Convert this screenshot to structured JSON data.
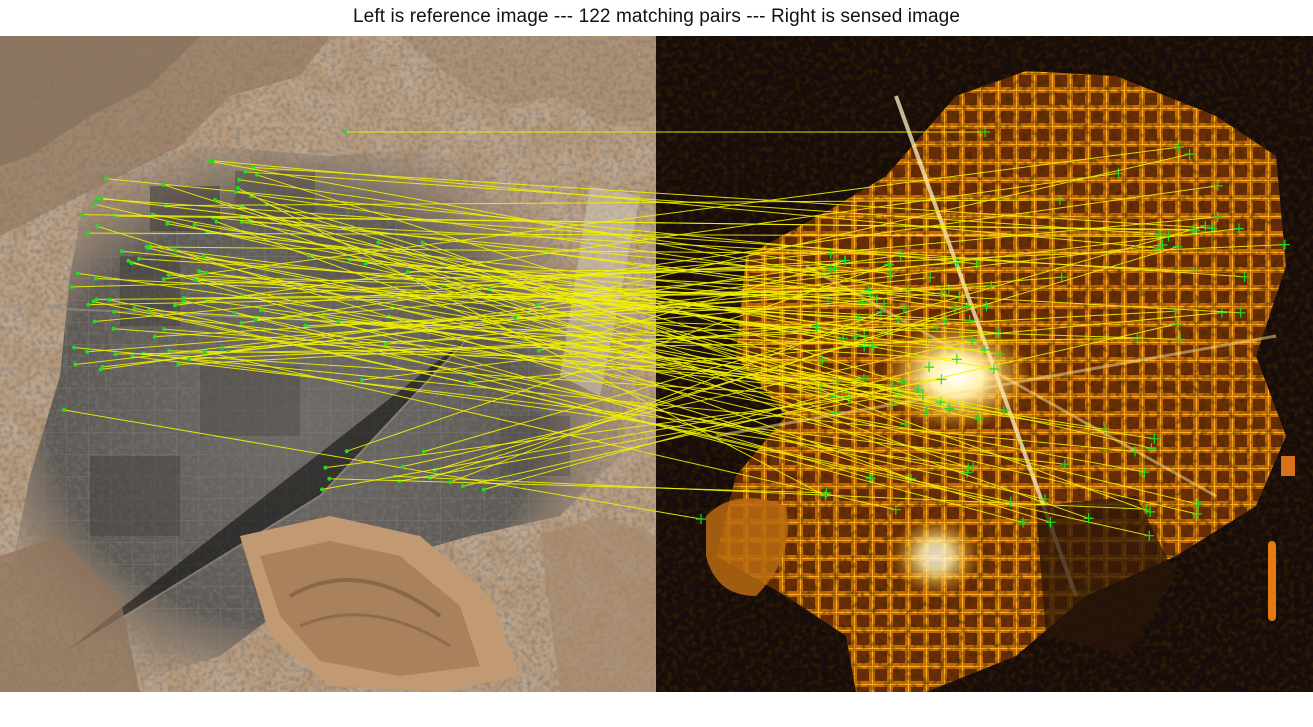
{
  "figure": {
    "title": "Left is reference image --- 122 matching pairs --- Right is sensed image"
  },
  "panels": [
    {
      "role": "reference",
      "content": "daytime satellite view of an urban area in a desert valley"
    },
    {
      "role": "sensed",
      "content": "night-time satellite view of city lights"
    }
  ],
  "colors": {
    "match_line": "#f2f200",
    "keypoint": "#22dd22",
    "background": "#ffffff"
  },
  "matches": {
    "count": 122
  }
}
